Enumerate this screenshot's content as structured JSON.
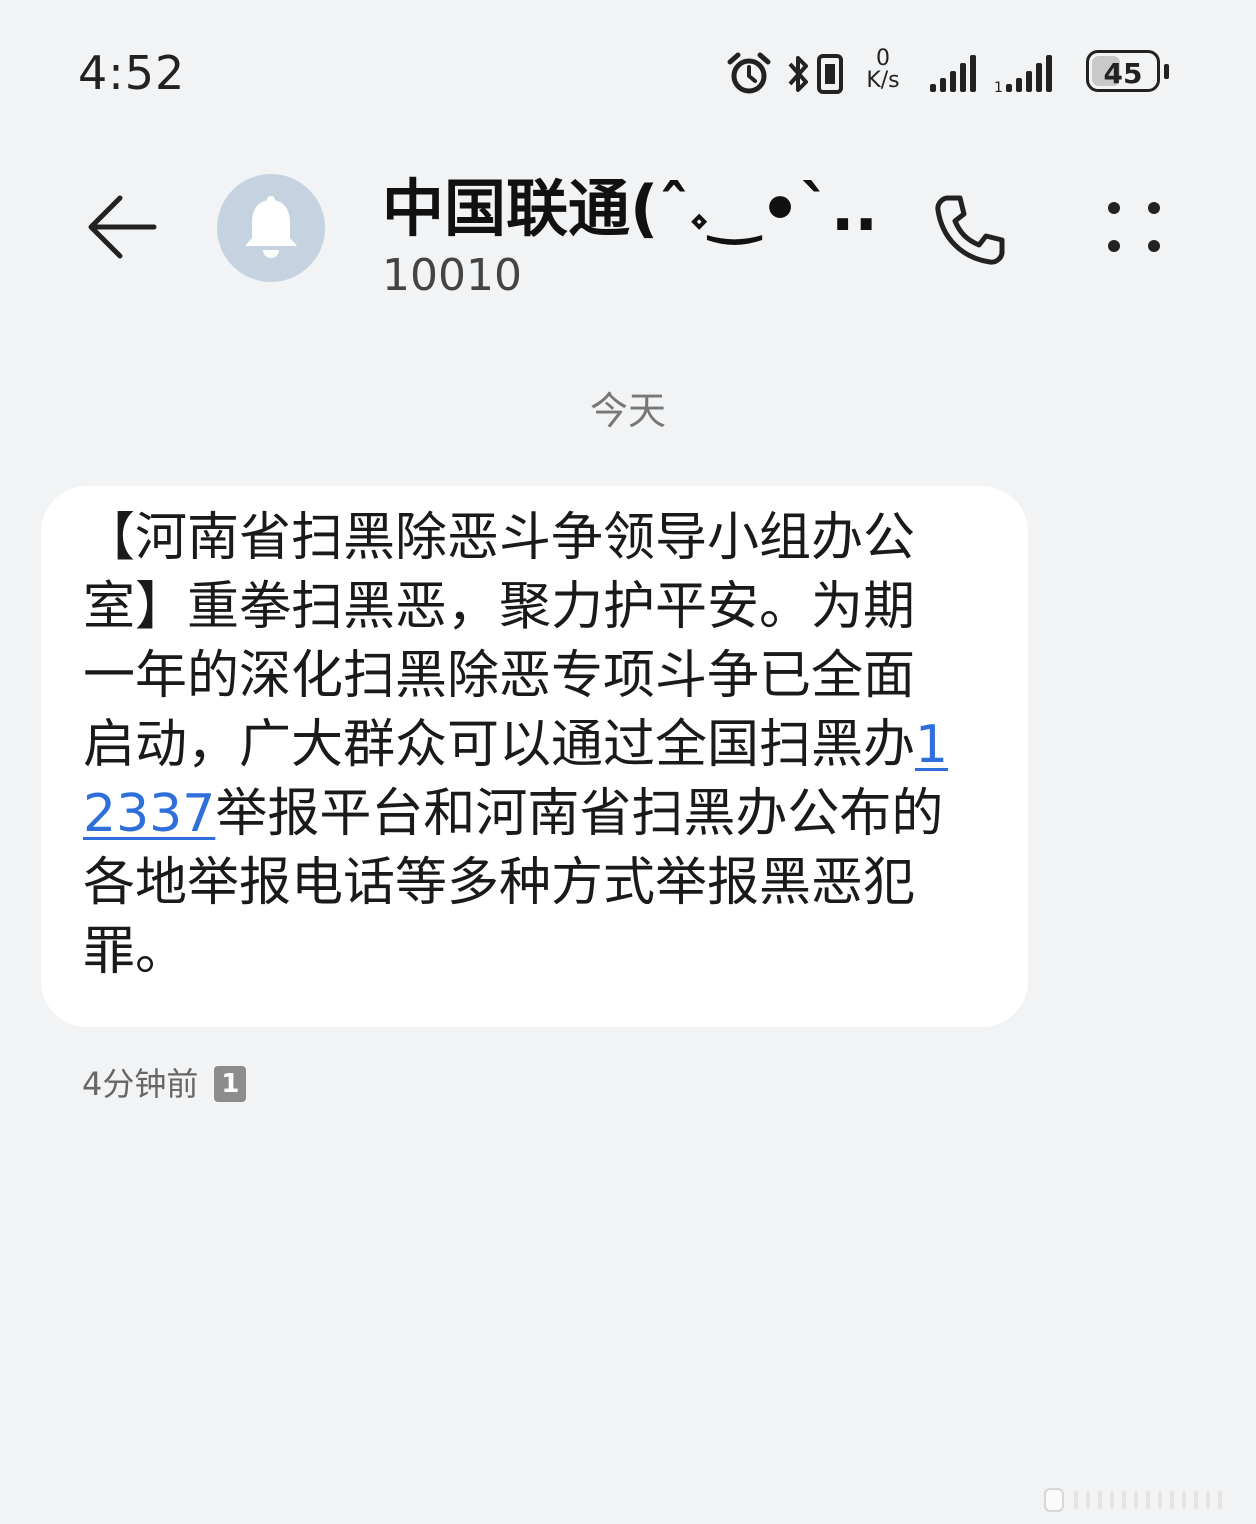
{
  "status_bar": {
    "time": "4:52",
    "net_speed_value": "0",
    "net_speed_unit": "K/s",
    "battery_level": "45",
    "battery_fill_fraction": 0.45,
    "icons": [
      "alarm-icon",
      "bluetooth-icon",
      "vibrate-icon",
      "signal-icon",
      "signal-hd-icon",
      "battery-icon"
    ]
  },
  "header": {
    "contact_name": "中国联通(ˆ𝆹‿•ˋ...",
    "contact_number": "10010",
    "avatar_icon": "bell-icon",
    "back_icon": "back-arrow-icon",
    "call_icon": "phone-icon",
    "more_icon": "more-dots-icon"
  },
  "date_divider": "今天",
  "message": {
    "text_before": "【河南省扫黑除恶斗争领导小组办公室】重拳扫黑恶，聚力护平安。为期一年的深化扫黑除恶专项斗争已全面启动，广大群众可以通过全国扫黑办",
    "phone_link": "12337",
    "text_after": "举报平台和河南省扫黑办公布的各地举报电话等多种方式举报黑恶犯罪。",
    "time": "4分钟前",
    "sim_slot": "1"
  },
  "colors": {
    "background": "#f1f3f5",
    "bubble": "#ffffff",
    "link": "#2f6fdb",
    "avatar": "#c5d3e1"
  }
}
